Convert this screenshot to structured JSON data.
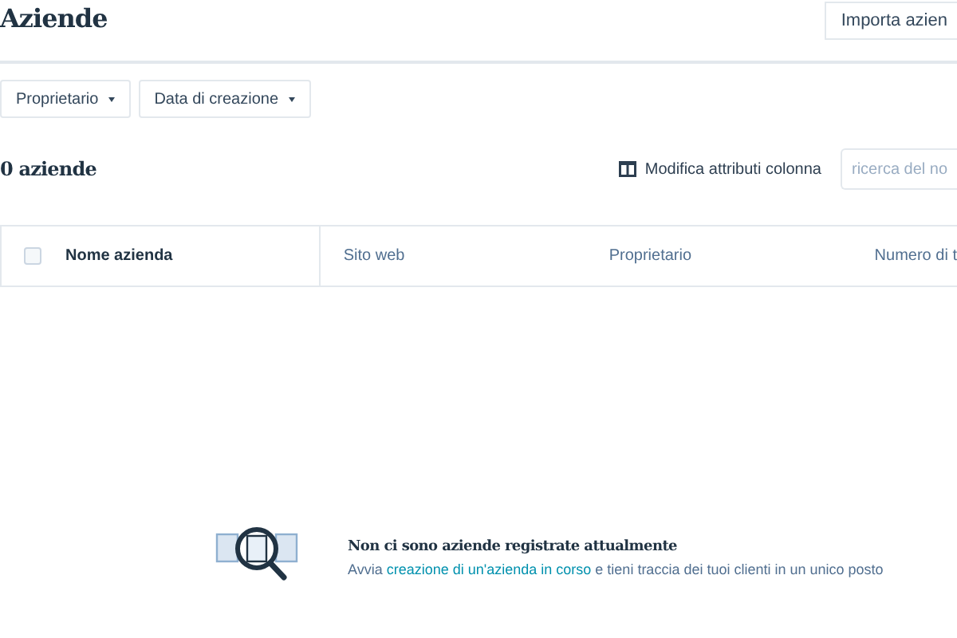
{
  "header": {
    "title": "Aziende",
    "import_button": "Importa azien"
  },
  "filters": [
    {
      "label": "Proprietario"
    },
    {
      "label": "Data di creazione"
    }
  ],
  "toolbar": {
    "count": "0 aziende",
    "edit_columns": "Modifica attributi colonna",
    "search": {
      "placeholder": "ricerca del no"
    }
  },
  "table": {
    "select_all": {
      "checked": false
    },
    "columns": [
      "Nome azienda",
      "Sito web",
      "Proprietario",
      "Numero di t"
    ]
  },
  "empty_state": {
    "title": "Non ci sono aziende registrate attualmente",
    "text_before": "Avvia ",
    "link": "creazione di un'azienda in corso",
    "text_after": " e tieni traccia dei tuoi clienti in un unico posto"
  }
}
